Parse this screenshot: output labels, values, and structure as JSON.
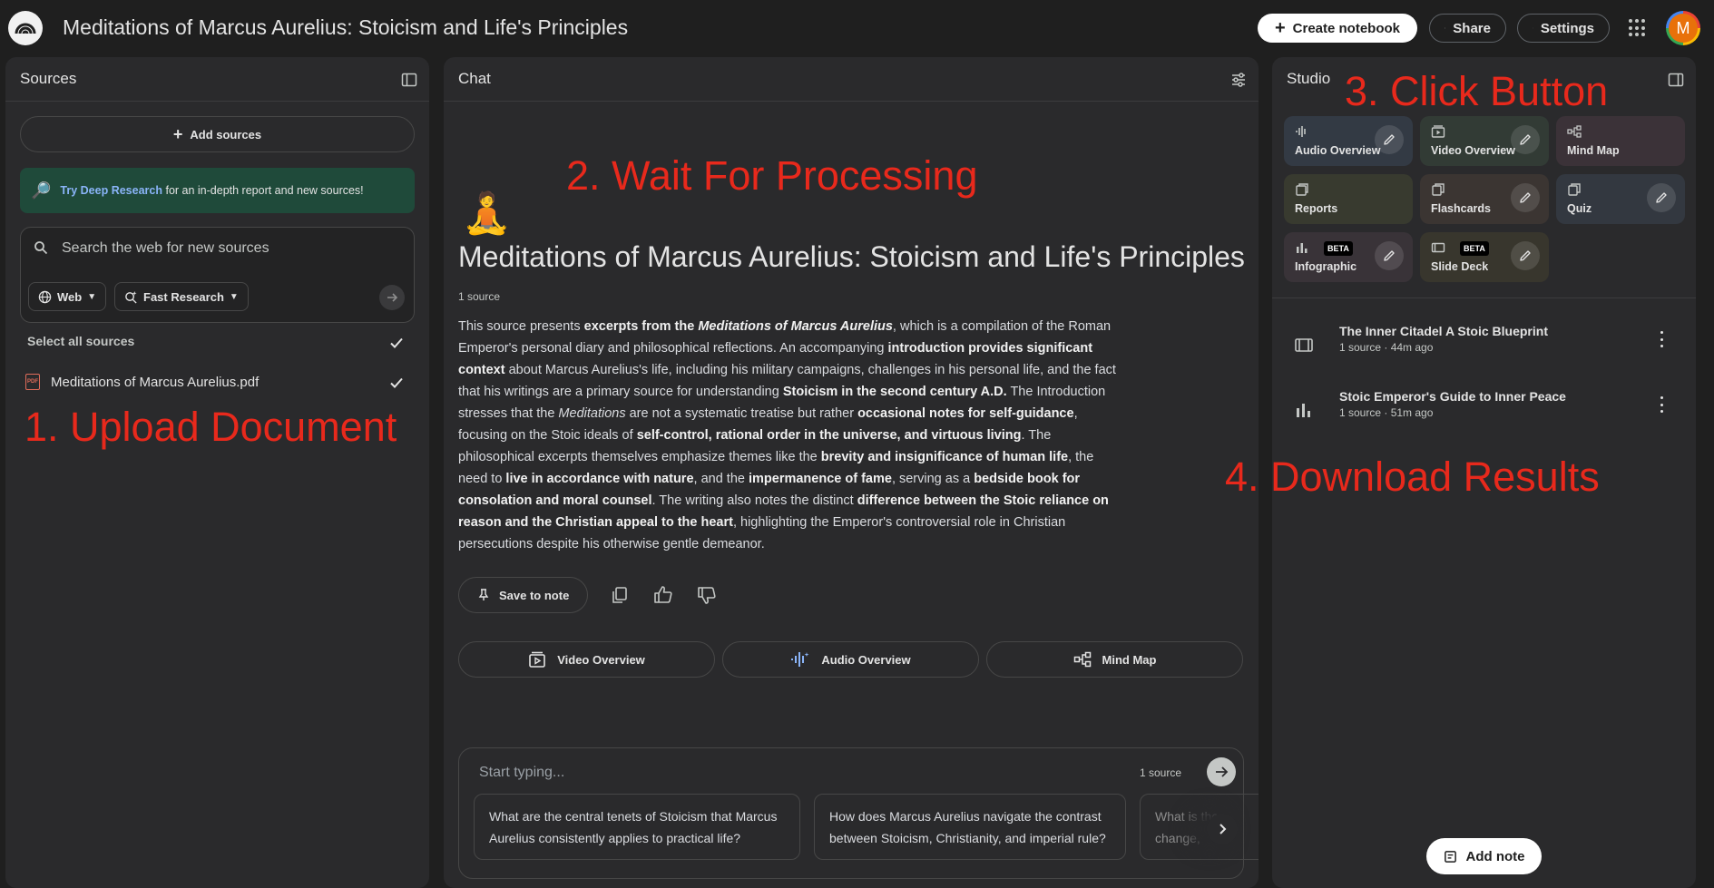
{
  "app": {
    "title": "Meditations of Marcus Aurelius: Stoicism and Life's Principles",
    "create_notebook": "Create notebook",
    "share": "Share",
    "settings": "Settings",
    "avatar_letter": "M"
  },
  "sources": {
    "title": "Sources",
    "add_sources": "Add sources",
    "deep_research_link": "Try Deep Research",
    "deep_research_text": "for an in-depth report and new sources!",
    "search_placeholder": "Search the web for new sources",
    "web_chip": "Web",
    "research_chip": "Fast Research",
    "select_all": "Select all sources",
    "items": [
      {
        "name": "Meditations of Marcus Aurelius.pdf",
        "checked": true
      }
    ]
  },
  "chat": {
    "title": "Chat",
    "notebook_title": "Meditations of Marcus Aurelius: Stoicism and Life's Principles",
    "source_count": "1 source",
    "summary_parts": [
      [
        "t",
        "This source presents "
      ],
      [
        "b",
        "excerpts from the "
      ],
      [
        "bi",
        "Meditations of Marcus Aurelius"
      ],
      [
        "t",
        ", which is a compilation of the Roman Emperor's personal diary and philosophical reflections. An accompanying "
      ],
      [
        "b",
        "introduction provides significant context"
      ],
      [
        "t",
        " about Marcus Aurelius's life, including his military campaigns, challenges in his personal life, and the fact that his writings are a primary source for understanding "
      ],
      [
        "b",
        "Stoicism in the second century A.D."
      ],
      [
        "t",
        " The Introduction stresses that the "
      ],
      [
        "i",
        "Meditations"
      ],
      [
        "t",
        " are not a systematic treatise but rather "
      ],
      [
        "b",
        "occasional notes for self-guidance"
      ],
      [
        "t",
        ", focusing on the Stoic ideals of "
      ],
      [
        "b",
        "self-control, rational order in the universe, and virtuous living"
      ],
      [
        "t",
        ". The philosophical excerpts themselves emphasize themes like the "
      ],
      [
        "b",
        "brevity and insignificance of human life"
      ],
      [
        "t",
        ", the need to "
      ],
      [
        "b",
        "live in accordance with nature"
      ],
      [
        "t",
        ", and the "
      ],
      [
        "b",
        "impermanence of fame"
      ],
      [
        "t",
        ", serving as a "
      ],
      [
        "b",
        "bedside book for consolation and moral counsel"
      ],
      [
        "t",
        ". The writing also notes the distinct "
      ],
      [
        "b",
        "difference between the Stoic reliance on reason and the Christian appeal to the heart"
      ],
      [
        "t",
        ", highlighting the Emperor's controversial role in Christian persecutions despite his otherwise gentle demeanor."
      ]
    ],
    "save_to_note": "Save to note",
    "quick_actions": [
      "Video Overview",
      "Audio Overview",
      "Mind Map"
    ],
    "composer_placeholder": "Start typing...",
    "composer_count": "1 source",
    "suggestions": [
      "What are the central tenets of Stoicism that Marcus Aurelius consistently applies to practical life?",
      "How does Marcus Aurelius navigate the contrast between Stoicism, Christianity, and imperial rule?",
      "What is the change,"
    ]
  },
  "studio": {
    "title": "Studio",
    "cards": [
      {
        "label": "Audio Overview",
        "icon": "audio-wave-icon",
        "color": "#333a44",
        "edit": true,
        "beta": false
      },
      {
        "label": "Video Overview",
        "icon": "video-icon",
        "color": "#323b35",
        "edit": true,
        "beta": false
      },
      {
        "label": "Mind Map",
        "icon": "mind-map-icon",
        "color": "#3b3238",
        "edit": false,
        "beta": false
      },
      {
        "label": "Reports",
        "icon": "reports-icon",
        "color": "#383a2f",
        "edit": false,
        "beta": false
      },
      {
        "label": "Flashcards",
        "icon": "flashcards-icon",
        "color": "#3b3532",
        "edit": true,
        "beta": false
      },
      {
        "label": "Quiz",
        "icon": "quiz-icon",
        "color": "#333840",
        "edit": true,
        "beta": false
      },
      {
        "label": "Infographic",
        "icon": "infographic-icon",
        "color": "#393338",
        "edit": true,
        "beta": true
      },
      {
        "label": "Slide Deck",
        "icon": "slide-deck-icon",
        "color": "#38362d",
        "edit": true,
        "beta": true
      }
    ],
    "beta_label": "BETA",
    "notes": [
      {
        "title": "The Inner Citadel A Stoic Blueprint",
        "meta": "1 source · 44m ago",
        "icon": "slide-deck-icon"
      },
      {
        "title": "Stoic Emperor's Guide to Inner Peace",
        "meta": "1 source · 51m ago",
        "icon": "infographic-icon"
      }
    ],
    "add_note": "Add note"
  },
  "annotations": {
    "step1": "1. Upload Document",
    "step2": "2. Wait For Processing",
    "step3": "3. Click Button",
    "step4": "4. Download Results",
    "color": "#e8291c"
  }
}
